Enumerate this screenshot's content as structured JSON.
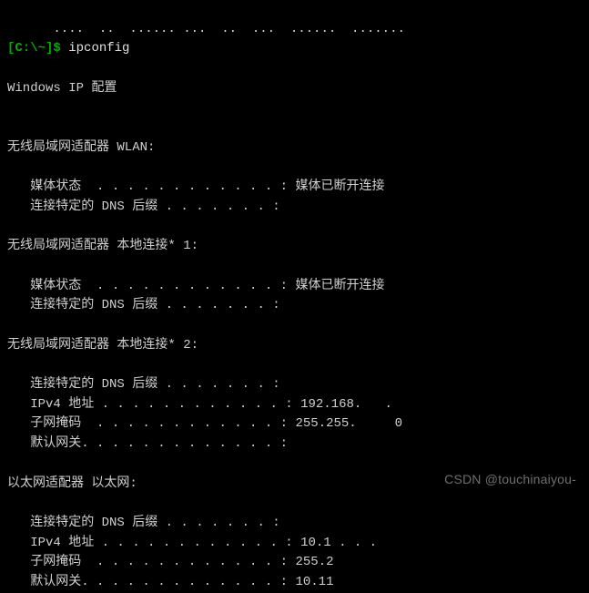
{
  "top_fragment": "      ....  ..  ...... ...  ..  ...  ......  .......",
  "prompt": {
    "open_bracket": "[",
    "path": "C:\\~",
    "close_bracket": "]",
    "dollar": "$",
    "command": "ipconfig"
  },
  "header": "Windows IP 配置",
  "adapters": [
    {
      "title": "无线局域网适配器 WLAN:",
      "rows": [
        {
          "label": "媒体状态  . . . . . . . . . . . . :",
          "value": " 媒体已断开连接"
        },
        {
          "label": "连接特定的 DNS 后缀 . . . . . . . :",
          "value": ""
        }
      ]
    },
    {
      "title": "无线局域网适配器 本地连接* 1:",
      "rows": [
        {
          "label": "媒体状态  . . . . . . . . . . . . :",
          "value": " 媒体已断开连接"
        },
        {
          "label": "连接特定的 DNS 后缀 . . . . . . . :",
          "value": ""
        }
      ]
    },
    {
      "title": "无线局域网适配器 本地连接* 2:",
      "rows": [
        {
          "label": "连接特定的 DNS 后缀 . . . . . . . :",
          "value": ""
        },
        {
          "label": "IPv4 地址 . . . . . . . . . . . . :",
          "value": " 192.168.   . "
        },
        {
          "label": "子网掩码  . . . . . . . . . . . . :",
          "value": " 255.255.     0"
        },
        {
          "label": "默认网关. . . . . . . . . . . . . :",
          "value": ""
        }
      ]
    },
    {
      "title": "以太网适配器 以太网:",
      "rows": [
        {
          "label": "连接特定的 DNS 后缀 . . . . . . . :",
          "value": ""
        },
        {
          "label": "IPv4 地址 . . . . . . . . . . . . :",
          "value": " 10.1 . . . "
        },
        {
          "label": "子网掩码  . . . . . . . . . . . . :",
          "value": " 255.2       "
        },
        {
          "label": "默认网关. . . . . . . . . . . . . :",
          "value": " 10.11       "
        }
      ]
    }
  ],
  "watermark": "CSDN @touchinaiyou-"
}
